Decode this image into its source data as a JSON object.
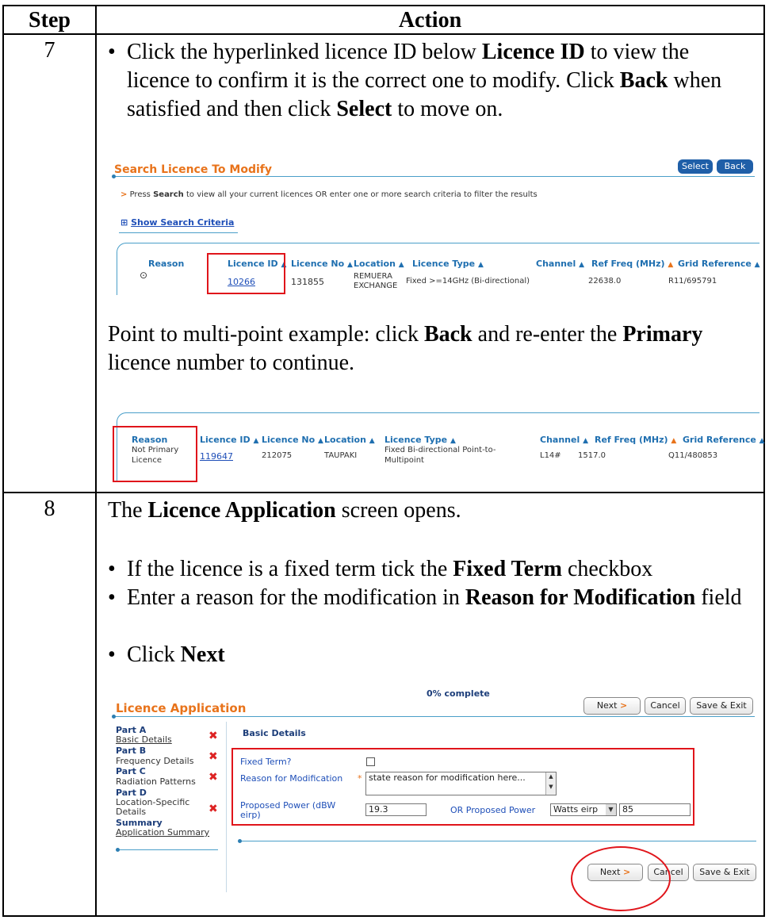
{
  "header": {
    "step": "Step",
    "action": "Action"
  },
  "step7": {
    "number": "7",
    "bullet1": {
      "pre": "Click the hyperlinked licence ID below ",
      "b1": "Licence ID",
      "mid1": " to view the licence to confirm it is the correct one to modify.  Click ",
      "b2": "Back",
      "mid2": " when satisfied and then click ",
      "b3": "Select",
      "post": " to move on."
    },
    "screen1": {
      "title": "Search Licence To Modify",
      "select_label": "Select",
      "back_label": "Back",
      "hint_arrow": ">",
      "hint_pre": "Press ",
      "hint_bold": "Search",
      "hint_post": " to view all your current licences OR enter one or more search criteria to filter the results",
      "criteria_icon": "⊞",
      "criteria_label": "Show Search Criteria",
      "columns": [
        "Reason",
        "Licence ID",
        "Licence No",
        "Location",
        "Licence Type",
        "Channel",
        "Ref Freq (MHz)",
        "Grid Reference"
      ],
      "row": {
        "reason": "",
        "licence_id": "10266",
        "licence_no": "131855",
        "location_1": "REMUERA",
        "location_2": "EXCHANGE",
        "licence_type": "Fixed >=14GHz (Bi-directional)",
        "channel": "",
        "ref_freq": "22638.0",
        "grid_ref": "R11/695791"
      }
    },
    "note": {
      "pre": "Point to multi-point example: click ",
      "b1": "Back",
      "mid": " and re-enter the ",
      "b2": "Primary",
      "post": " licence number to continue."
    },
    "screen2": {
      "columns": [
        "Reason",
        "Licence ID",
        "Licence No",
        "Location",
        "Licence Type",
        "Channel",
        "Ref Freq (MHz)",
        "Grid Reference"
      ],
      "row": {
        "reason_1": "Not Primary",
        "reason_2": "Licence",
        "licence_id": "119647",
        "licence_no": "212075",
        "location": "TAUPAKI",
        "licence_type_1": "Fixed Bi-directional Point-to-",
        "licence_type_2": "Multipoint",
        "channel": "L14#",
        "ref_freq": "1517.0",
        "grid_ref": "Q11/480853"
      }
    }
  },
  "step8": {
    "number": "8",
    "intro": {
      "pre": "The ",
      "b1": "Licence Application",
      "post": " screen opens."
    },
    "bullets": [
      {
        "pre": "If the licence is a fixed term tick the ",
        "b": "Fixed Term",
        "post": " checkbox"
      },
      {
        "pre": "Enter a reason for the modification in ",
        "b": "Reason for Modification",
        "post": " field"
      },
      {
        "pre": "Click ",
        "b": "Next",
        "post": ""
      }
    ],
    "screen3": {
      "progress": "0% complete",
      "title": "Licence Application",
      "next_label": "Next",
      "cancel_label": "Cancel",
      "save_exit_label": "Save & Exit",
      "nav": [
        {
          "part": "Part A",
          "item": "Basic Details",
          "linked": true
        },
        {
          "part": "Part B",
          "item": "Frequency Details",
          "linked": false
        },
        {
          "part": "Part C",
          "item": "Radiation Patterns",
          "linked": false
        },
        {
          "part": "Part D",
          "item": "Location-Specific Details",
          "linked": false
        },
        {
          "part": "Summary",
          "item": "Application Summary",
          "linked": true
        }
      ],
      "section_title": "Basic Details",
      "fixed_term_label": "Fixed Term?",
      "reason_label": "Reason for Modification",
      "required_mark": "*",
      "reason_value": "state reason for modification here...",
      "power_label_1": "Proposed Power (dBW",
      "power_label_2": "eirp)",
      "power_value": "19.3",
      "or_power_label": "OR Proposed Power",
      "unit_value": "Watts eirp",
      "watts_value": "85"
    }
  }
}
